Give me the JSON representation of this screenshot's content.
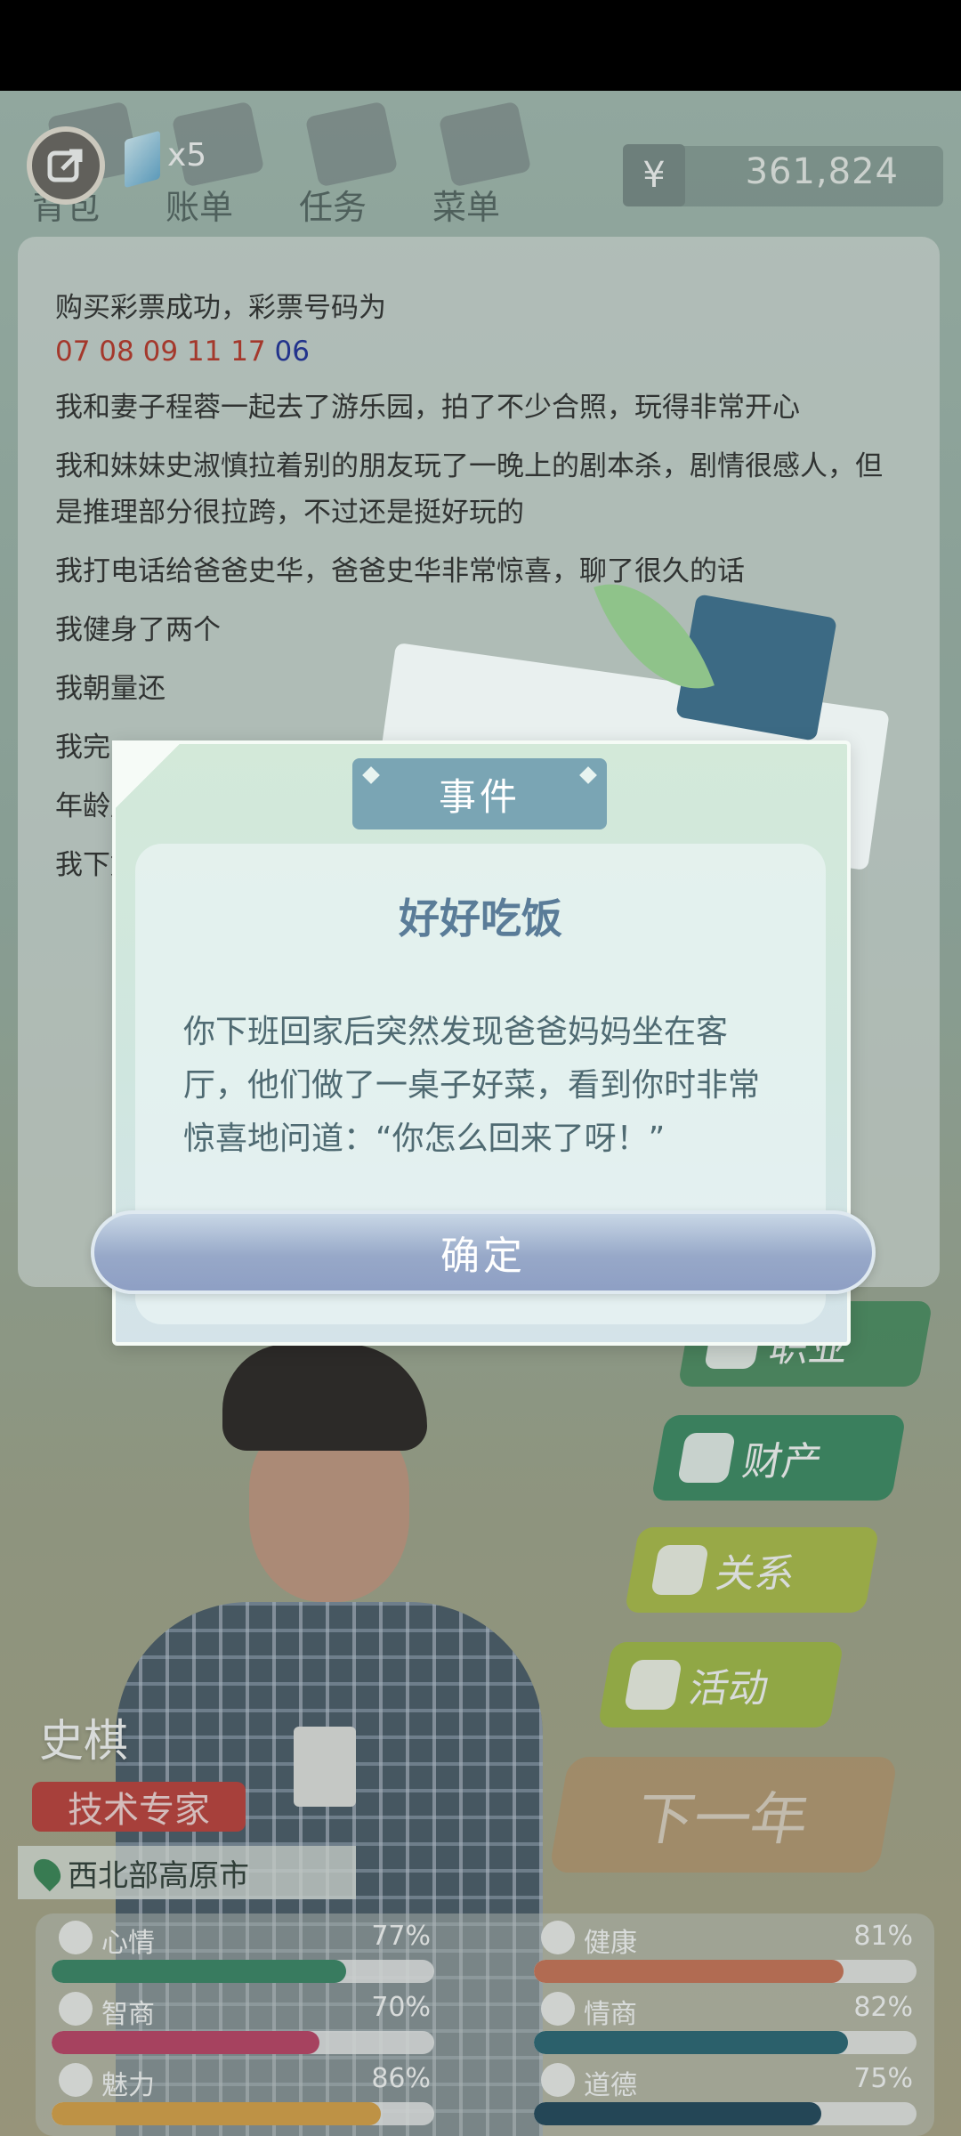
{
  "top_nav": {
    "items": [
      {
        "label": "背包"
      },
      {
        "label": "账单"
      },
      {
        "label": "任务"
      },
      {
        "label": "菜单"
      }
    ],
    "gem_count": "x5",
    "currency_symbol": "¥",
    "money": "361,824"
  },
  "log": {
    "lottery_line": "购买彩票成功，彩票号码为",
    "lottery_red": "07 08 09 11 17 ",
    "lottery_blue": "06",
    "entries": [
      "我和妻子程蓉一起去了游乐园，拍了不少合照，玩得非常开心",
      "我和妹妹史淑慎拉着别的朋友玩了一晚上的剧本杀，剧情很感人，但是推理部分很拉跨，不过还是挺好玩的",
      "我打电话给爸爸史华，爸爸史华非常惊喜，聊了很久的话",
      "我健身了两个",
      "我朝量还",
      "我完",
      "年龄朋友",
      "我下好"
    ]
  },
  "dialog": {
    "tab_label": "事件",
    "title": "好好吃饭",
    "text": "你下班回家后突然发现爸爸妈妈坐在客厅，他们做了一桌子好菜，看到你时非常惊喜地问道：“你怎么回来了呀！”",
    "confirm_label": "确定"
  },
  "side_menu": {
    "career": "职业",
    "property": "财产",
    "relation": "关系",
    "activity": "活动",
    "next_year": "下一年"
  },
  "character": {
    "name": "史棋",
    "title": "技术专家",
    "location": "西北部高原市"
  },
  "stats": [
    {
      "label": "心情",
      "value": "77%",
      "fraction": 0.77,
      "color": "#3c8a6a"
    },
    {
      "label": "健康",
      "value": "81%",
      "fraction": 0.81,
      "color": "#d0775a"
    },
    {
      "label": "智商",
      "value": "70%",
      "fraction": 0.7,
      "color": "#c2456a"
    },
    {
      "label": "情商",
      "value": "82%",
      "fraction": 0.82,
      "color": "#2d6a78"
    },
    {
      "label": "魅力",
      "value": "86%",
      "fraction": 0.86,
      "color": "#e0a64a"
    },
    {
      "label": "道德",
      "value": "75%",
      "fraction": 0.75,
      "color": "#244a5e"
    }
  ]
}
